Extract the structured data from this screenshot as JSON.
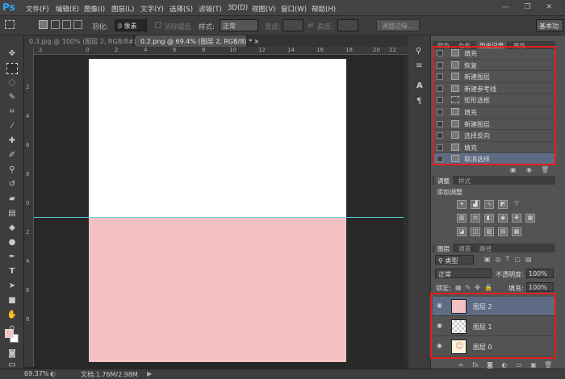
{
  "app": {
    "logo": "Ps"
  },
  "menu": [
    "文件(F)",
    "编辑(E)",
    "图像(I)",
    "图层(L)",
    "文字(Y)",
    "选择(S)",
    "滤镜(T)",
    "3D(D)",
    "视图(V)",
    "窗口(W)",
    "帮助(H)"
  ],
  "window_controls": "— ❐ ✕",
  "options": {
    "feather_label": "羽化:",
    "feather_value": "0 像素",
    "antialias_label": "消除锯齿",
    "style_label": "样式:",
    "style_value": "正常",
    "width_label": "宽度:",
    "height_label": "高度:",
    "refine_button": "调整边缘...",
    "workspace": "基本功"
  },
  "tabs": [
    {
      "label": "0.3.jpg @ 100% (图层 2, RGB/8#) *",
      "close": "×"
    },
    {
      "label": "0.2.png @ 69.4% (图层 2, RGB/8) *",
      "close": "×"
    }
  ],
  "ruler_h": [
    "2",
    "0",
    "2",
    "4",
    "6",
    "8",
    "10",
    "12",
    "14",
    "16",
    "18",
    "20",
    "22"
  ],
  "ruler_v": [
    "2",
    "4",
    "6",
    "8",
    "0",
    "2",
    "4",
    "6",
    "8"
  ],
  "status": {
    "zoom": "69.37%",
    "doc": "文档:1.76M/2.98M"
  },
  "panel_tabs_top": [
    "颜色",
    "色板",
    "历史记录",
    "属性"
  ],
  "history": [
    {
      "label": "填充"
    },
    {
      "label": "恢复"
    },
    {
      "label": "新建图层"
    },
    {
      "label": "新建参考线"
    },
    {
      "label": "矩形选框"
    },
    {
      "label": "填充"
    },
    {
      "label": "新建图层"
    },
    {
      "label": "选择反向"
    },
    {
      "label": "填充"
    },
    {
      "label": "取消选择"
    }
  ],
  "adjust_tabs": [
    "调整",
    "样式"
  ],
  "adjust_title": "添加调整",
  "layers_tabs": [
    "图层",
    "通道",
    "路径"
  ],
  "layers": {
    "filter_kind": "类型",
    "blend_mode": "正常",
    "opacity_label": "不透明度:",
    "opacity_value": "100%",
    "lock_label": "锁定:",
    "fill_label": "填充:",
    "fill_value": "100%",
    "items": [
      {
        "label": "图层 2"
      },
      {
        "label": "图层 1"
      },
      {
        "label": "图层 0"
      }
    ]
  },
  "colors": {
    "accent_blue": "#31a8ff",
    "highlight": "#5d6b85",
    "red_box": "#e02020",
    "pink_fill": "#f4c2c2",
    "guide": "#5ed3e3"
  }
}
